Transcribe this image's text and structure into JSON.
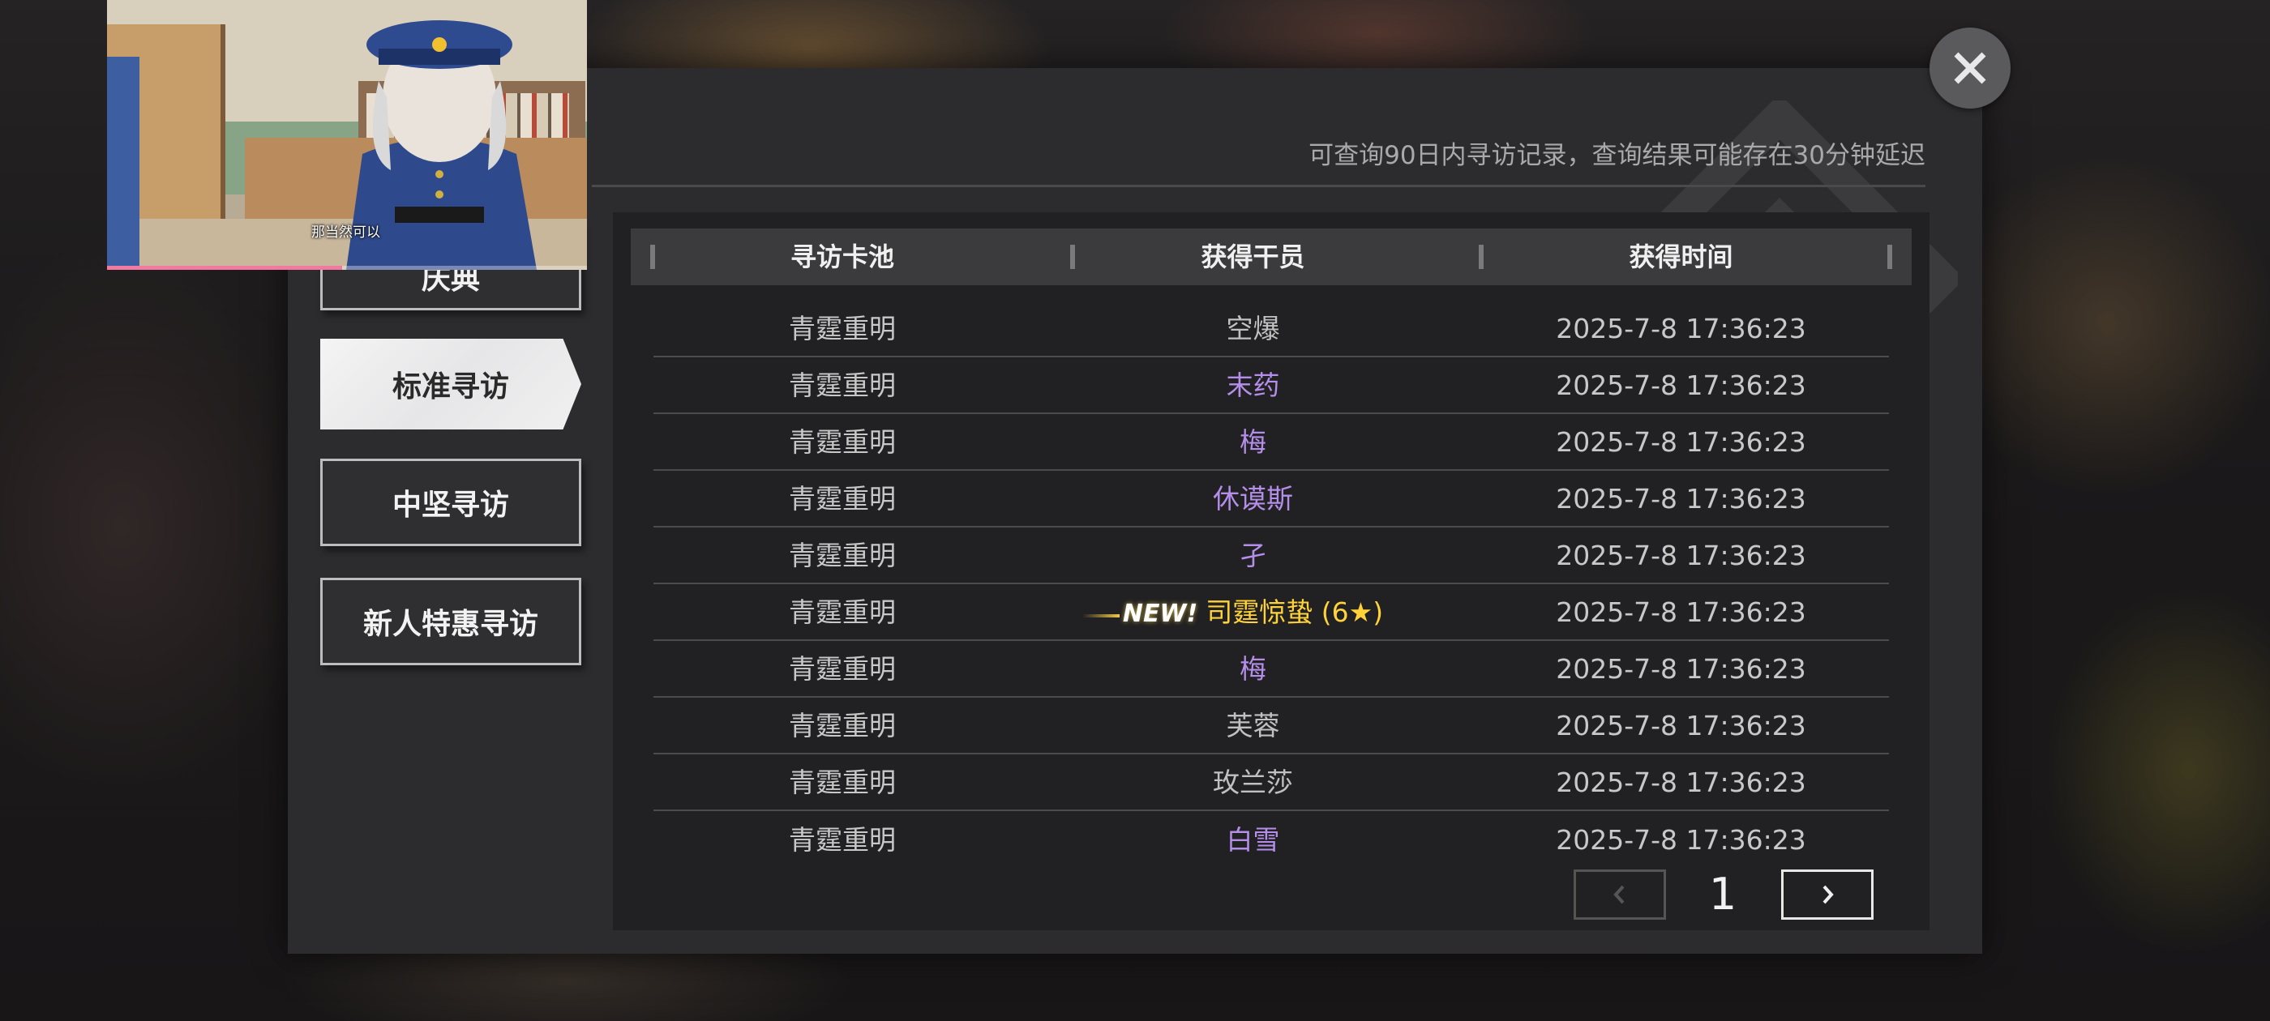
{
  "notice": "可查询90日内寻访记录，查询结果可能存在30分钟延迟",
  "tabs": [
    {
      "label": "庆典",
      "active": false
    },
    {
      "label": "标准寻访",
      "active": true
    },
    {
      "label": "中坚寻访",
      "active": false
    },
    {
      "label": "新人特惠寻访",
      "active": false
    }
  ],
  "table": {
    "headers": [
      "寻访卡池",
      "获得干员",
      "获得时间"
    ],
    "rows": [
      {
        "pool": "青霆重明",
        "operator": "空爆",
        "rarity": 3,
        "time": "2025-7-8 17:36:23"
      },
      {
        "pool": "青霆重明",
        "operator": "末药",
        "rarity": 4,
        "time": "2025-7-8 17:36:23"
      },
      {
        "pool": "青霆重明",
        "operator": "梅",
        "rarity": 4,
        "time": "2025-7-8 17:36:23"
      },
      {
        "pool": "青霆重明",
        "operator": "休谟斯",
        "rarity": 4,
        "time": "2025-7-8 17:36:23"
      },
      {
        "pool": "青霆重明",
        "operator": "孑",
        "rarity": 4,
        "time": "2025-7-8 17:36:23"
      },
      {
        "pool": "青霆重明",
        "operator": "司霆惊蛰 (6★)",
        "rarity": 6,
        "new": "NEW!",
        "time": "2025-7-8 17:36:23"
      },
      {
        "pool": "青霆重明",
        "operator": "梅",
        "rarity": 4,
        "time": "2025-7-8 17:36:23"
      },
      {
        "pool": "青霆重明",
        "operator": "芙蓉",
        "rarity": 3,
        "time": "2025-7-8 17:36:23"
      },
      {
        "pool": "青霆重明",
        "operator": "玫兰莎",
        "rarity": 3,
        "time": "2025-7-8 17:36:23"
      },
      {
        "pool": "青霆重明",
        "operator": "白雪",
        "rarity": 4,
        "time": "2025-7-8 17:36:23"
      }
    ]
  },
  "pager": {
    "page": "1",
    "prev_enabled": false,
    "next_enabled": true
  },
  "icons": {
    "close": "close-icon",
    "prev": "chevron-left-icon",
    "next": "chevron-right-icon"
  },
  "video": {
    "subtitle": "那当然可以",
    "progress": 0.49
  },
  "colors": {
    "rarity4": "#b48ee8",
    "rarity6": "#ffd23a",
    "rarity3": "#c0c0c0",
    "panel": "#2c2c2e"
  }
}
